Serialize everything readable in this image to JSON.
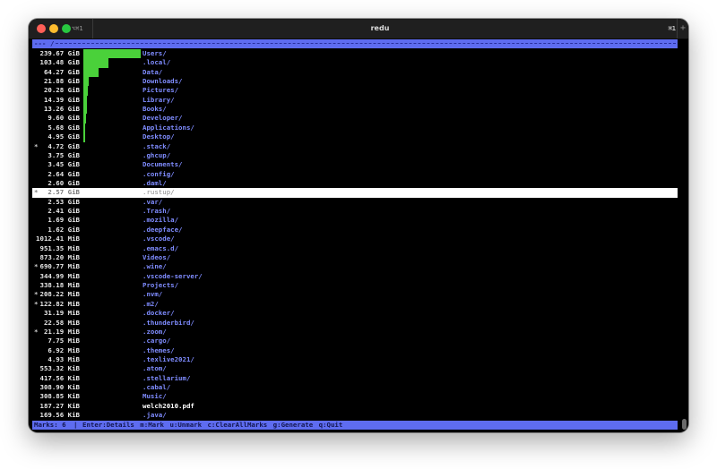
{
  "window": {
    "title": "redu",
    "shortcut_left": "⌥⌘1",
    "shortcut_right": "⌘1",
    "new_tab": "+"
  },
  "header": {
    "path": "---",
    "separator": "/"
  },
  "rows": [
    {
      "mark": "",
      "size": "239.67 GiB",
      "name": "Users/",
      "bar": 1.0
    },
    {
      "mark": "",
      "size": "103.48 GiB",
      "name": ".local/",
      "bar": 0.432
    },
    {
      "mark": "",
      "size": "64.27 GiB",
      "name": "Data/",
      "bar": 0.268
    },
    {
      "mark": "",
      "size": "21.88 GiB",
      "name": "Downloads/",
      "bar": 0.091
    },
    {
      "mark": "",
      "size": "20.28 GiB",
      "name": "Pictures/",
      "bar": 0.085
    },
    {
      "mark": "",
      "size": "14.39 GiB",
      "name": "Library/",
      "bar": 0.06
    },
    {
      "mark": "",
      "size": "13.26 GiB",
      "name": "Books/",
      "bar": 0.055
    },
    {
      "mark": "",
      "size": "9.60 GiB",
      "name": "Developer/",
      "bar": 0.04
    },
    {
      "mark": "",
      "size": "5.68 GiB",
      "name": "Applications/",
      "bar": 0.024
    },
    {
      "mark": "",
      "size": "4.95 GiB",
      "name": "Desktop/",
      "bar": 0.021
    },
    {
      "mark": "*",
      "size": "4.72 GiB",
      "name": ".stack/",
      "bar": 0.0
    },
    {
      "mark": "",
      "size": "3.75 GiB",
      "name": ".ghcup/",
      "bar": 0.0
    },
    {
      "mark": "",
      "size": "3.45 GiB",
      "name": "Documents/",
      "bar": 0.0
    },
    {
      "mark": "",
      "size": "2.64 GiB",
      "name": ".config/",
      "bar": 0.0
    },
    {
      "mark": "",
      "size": "2.60 GiB",
      "name": ".daml/",
      "bar": 0.0
    },
    {
      "mark": "*",
      "size": "2.57 GiB",
      "name": ".rustup/",
      "bar": 0.0,
      "selected": true
    },
    {
      "mark": "",
      "size": "2.53 GiB",
      "name": ".var/",
      "bar": 0.0
    },
    {
      "mark": "",
      "size": "2.41 GiB",
      "name": ".Trash/",
      "bar": 0.0
    },
    {
      "mark": "",
      "size": "1.69 GiB",
      "name": ".mozilla/",
      "bar": 0.0
    },
    {
      "mark": "",
      "size": "1.62 GiB",
      "name": ".deepface/",
      "bar": 0.0
    },
    {
      "mark": "",
      "size": "1012.41 MiB",
      "name": ".vscode/",
      "bar": 0.0
    },
    {
      "mark": "",
      "size": "951.35 MiB",
      "name": ".emacs.d/",
      "bar": 0.0
    },
    {
      "mark": "",
      "size": "873.20 MiB",
      "name": "Videos/",
      "bar": 0.0
    },
    {
      "mark": "*",
      "size": "690.77 MiB",
      "name": ".wine/",
      "bar": 0.0
    },
    {
      "mark": "",
      "size": "344.99 MiB",
      "name": ".vscode-server/",
      "bar": 0.0
    },
    {
      "mark": "",
      "size": "338.18 MiB",
      "name": "Projects/",
      "bar": 0.0
    },
    {
      "mark": "*",
      "size": "208.22 MiB",
      "name": ".nvm/",
      "bar": 0.0
    },
    {
      "mark": "*",
      "size": "122.82 MiB",
      "name": ".m2/",
      "bar": 0.0
    },
    {
      "mark": "",
      "size": "31.19 MiB",
      "name": ".docker/",
      "bar": 0.0
    },
    {
      "mark": "",
      "size": "22.58 MiB",
      "name": ".thunderbird/",
      "bar": 0.0
    },
    {
      "mark": "*",
      "size": "21.19 MiB",
      "name": ".zoom/",
      "bar": 0.0
    },
    {
      "mark": "",
      "size": "7.75 MiB",
      "name": ".cargo/",
      "bar": 0.0
    },
    {
      "mark": "",
      "size": "6.92 MiB",
      "name": ".themes/",
      "bar": 0.0
    },
    {
      "mark": "",
      "size": "4.93 MiB",
      "name": ".texlive2021/",
      "bar": 0.0
    },
    {
      "mark": "",
      "size": "553.32 KiB",
      "name": ".atom/",
      "bar": 0.0
    },
    {
      "mark": "",
      "size": "417.56 KiB",
      "name": ".stellarium/",
      "bar": 0.0
    },
    {
      "mark": "",
      "size": "308.90 KiB",
      "name": ".cabal/",
      "bar": 0.0
    },
    {
      "mark": "",
      "size": "308.85 KiB",
      "name": "Music/",
      "bar": 0.0
    },
    {
      "mark": "",
      "size": "187.27 KiB",
      "name": "welch2010.pdf",
      "bar": 0.0,
      "file": true
    },
    {
      "mark": "",
      "size": "169.56 KiB",
      "name": ".java/",
      "bar": 0.0
    }
  ],
  "footer": {
    "marks": "Marks: 6",
    "separator": "|",
    "keys": "Enter:Details m:Mark u:Unmark c:ClearAllMarks g:Generate q:Quit"
  },
  "colors": {
    "bar_green": "#4ad13a",
    "accent_blue": "#5e6cf0",
    "dir_blue": "#7f8cff",
    "background": "#000000"
  }
}
